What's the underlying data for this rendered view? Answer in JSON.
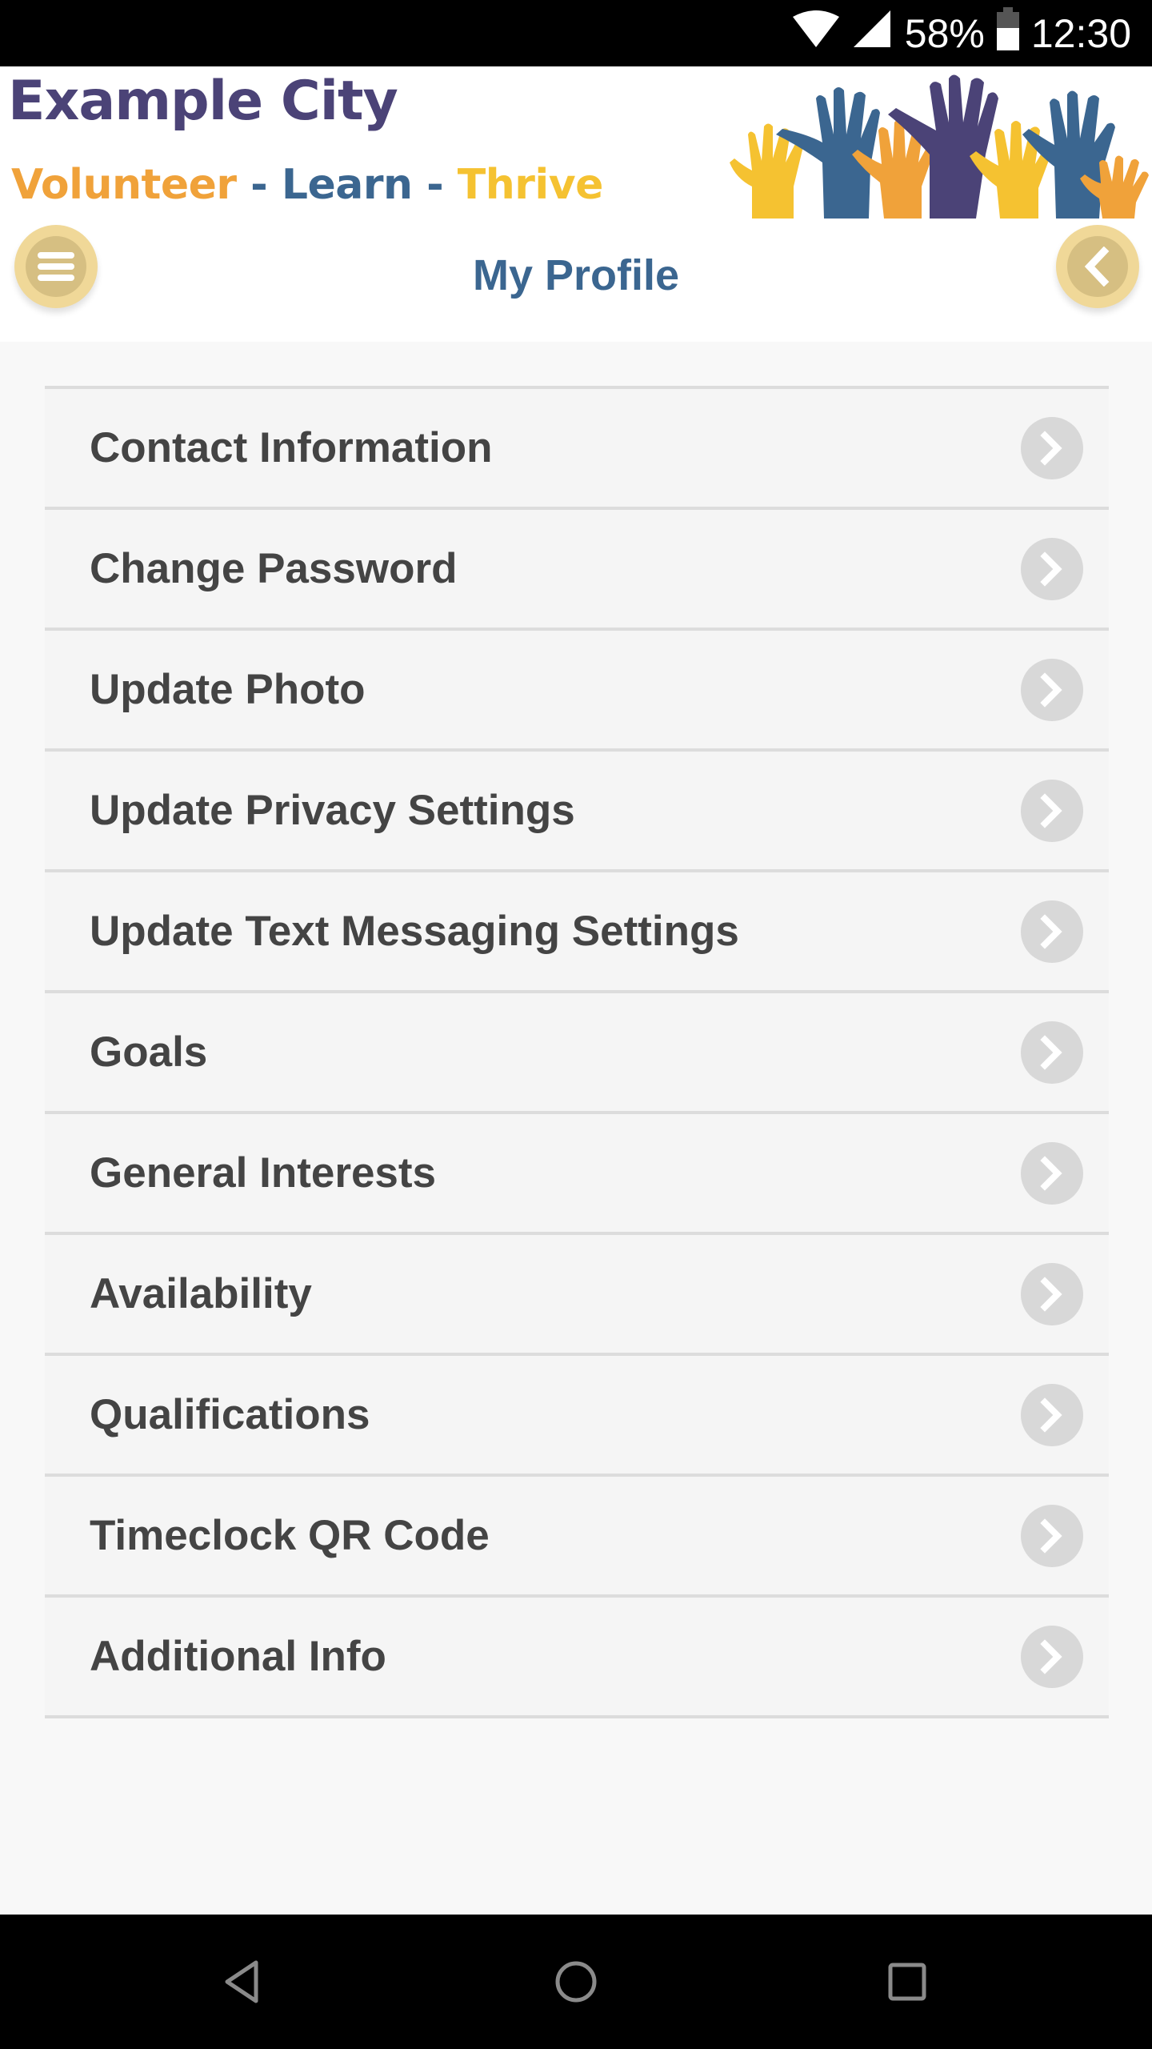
{
  "status_bar": {
    "battery_percent": "58%",
    "time": "12:30",
    "icons": [
      "wifi-icon",
      "cell-signal-icon",
      "battery-icon"
    ]
  },
  "header": {
    "logo_title": "Example City",
    "tagline": {
      "part1": "Volunteer",
      "sep1": " - ",
      "part2": "Learn",
      "sep2": " - ",
      "part3": "Thrive"
    },
    "page_title": "My Profile",
    "menu_button_icon": "hamburger-menu-icon",
    "back_button_icon": "chevron-left-icon"
  },
  "colors": {
    "brand_purple": "#4b4377",
    "brand_blue": "#3b6690",
    "brand_orange": "#f0a23a",
    "brand_yellow": "#f5c231",
    "button_gold": "#f0d898"
  },
  "menu": {
    "items": [
      {
        "label": "Contact Information"
      },
      {
        "label": "Change Password"
      },
      {
        "label": "Update Photo"
      },
      {
        "label": "Update Privacy Settings"
      },
      {
        "label": "Update Text Messaging Settings"
      },
      {
        "label": "Goals"
      },
      {
        "label": "General Interests"
      },
      {
        "label": "Availability"
      },
      {
        "label": "Qualifications"
      },
      {
        "label": "Timeclock QR Code"
      },
      {
        "label": "Additional Info"
      }
    ]
  },
  "nav_bar": {
    "buttons": [
      "back-icon",
      "home-icon",
      "recents-icon"
    ]
  }
}
